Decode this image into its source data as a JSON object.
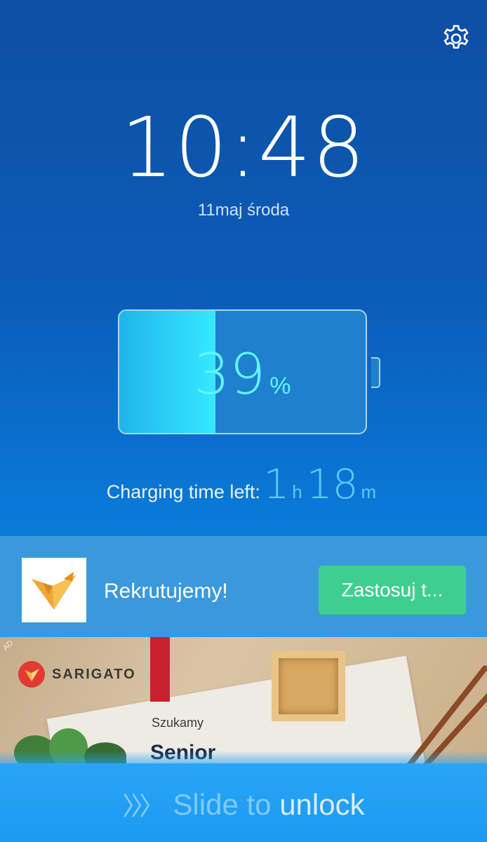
{
  "status": {
    "time": "10:48",
    "date": "11maj  środa"
  },
  "battery": {
    "percent_value": "39",
    "percent_sign": "%",
    "level_fraction": 0.39,
    "charge_label": "Charging time left:",
    "hours": "1",
    "hours_unit": "h",
    "minutes": "18",
    "minutes_unit": "m"
  },
  "ad": {
    "title": "Rekrutujemy!",
    "button_label": "Zastosuj t...",
    "banner_brand": "SARIGATO",
    "banner_line1": "Szukamy",
    "banner_line2": "Senior",
    "ad_badge": "AD"
  },
  "unlock": {
    "chevrons": "〉〉〉",
    "text_a": "Slide to ",
    "text_b": "unlock"
  },
  "colors": {
    "background_top": "#0d4fa3",
    "background_bottom": "#0a8ce6",
    "battery_fill": "#36e8ff",
    "percent_text": "#5ff6ff",
    "apply_button": "#3ecf8e",
    "ad_bar": "#3a99dc"
  },
  "icons": {
    "settings": "gear-icon",
    "ad_logo": "origami-bird-icon",
    "unlock_arrows": "chevron-right-icon"
  }
}
